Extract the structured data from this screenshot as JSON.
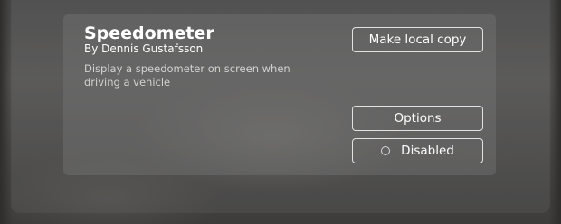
{
  "mod": {
    "title": "Speedometer",
    "author": "By Dennis Gustafsson",
    "description": "Display a speedometer on screen when driving a vehicle"
  },
  "actions": {
    "copy_label": "Make local copy",
    "options_label": "Options",
    "toggle_label": "Disabled",
    "toggle_icon": "radio-off-icon"
  }
}
